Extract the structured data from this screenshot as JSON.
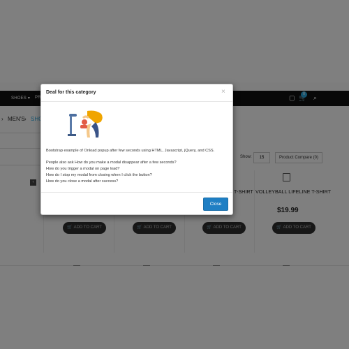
{
  "navbar": {
    "items": [
      "SHOES",
      "PR"
    ],
    "cart_count": "0"
  },
  "breadcrumb": {
    "items": [
      "MEN'S",
      "SHO"
    ]
  },
  "toolbar": {
    "show_label": "Show:",
    "show_value": "15",
    "compare_label": "Product Compare (0)"
  },
  "products": [
    {
      "title": "T-SHIRT",
      "price": ""
    },
    {
      "title": "VOLLEYBALL LIFELINE T-SHIRT",
      "price": "$19.99"
    }
  ],
  "add_to_cart_label": "ADD TO CART",
  "modal": {
    "title": "Deal for this category",
    "close_icon": "×",
    "intro": "Bootstrap example of Onload popup after few seconds using HTML, Javascript, jQuery, and CSS.",
    "faq": [
      "People also ask How do you make a modal disappear after a few seconds?",
      "How do you trigger a modal on page load?",
      "How do I stop my modal from closing when I click the button?",
      "How do you close a modal after success?"
    ],
    "close_button_label": "Close"
  },
  "colors": {
    "overlay": "rgba(0,0,0,0.5)",
    "close_button": "#1f7fc4",
    "navbar": "#111111",
    "cart_badge": "#2aa8e0"
  },
  "icons": {
    "nav_user": "user-icon",
    "nav_cart": "cart-icon",
    "nav_search": "search-icon",
    "modal_close": "close-icon",
    "illustration": "person-stretching-illustration"
  }
}
